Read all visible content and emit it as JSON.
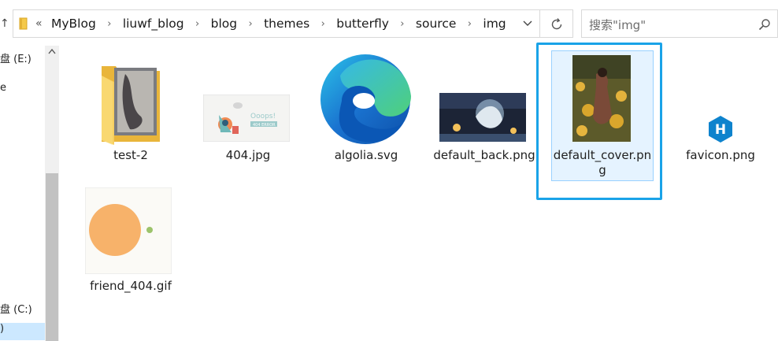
{
  "address_bar": {
    "overflow_symbol": "«",
    "breadcrumbs": [
      "MyBlog",
      "liuwf_blog",
      "blog",
      "themes",
      "butterfly",
      "source",
      "img"
    ],
    "separator": "›"
  },
  "search": {
    "placeholder": "搜索\"img\""
  },
  "nav_pane": {
    "items": [
      {
        "label": "盘 (E:)"
      },
      {
        "label": "e"
      },
      {
        "label": "盘 (C:)"
      },
      {
        "label": ")"
      }
    ]
  },
  "files": [
    {
      "name": "test-2",
      "type": "folder"
    },
    {
      "name": "404.jpg",
      "type": "image"
    },
    {
      "name": "algolia.svg",
      "type": "svg"
    },
    {
      "name": "default_back.png",
      "type": "image"
    },
    {
      "name": "default_cover.png",
      "type": "image",
      "selected": true
    },
    {
      "name": "favicon.png",
      "type": "image"
    },
    {
      "name": "friend_404.gif",
      "type": "gif"
    }
  ],
  "thumb_text": {
    "ooops": "Ooops!",
    "error_code": "404 ERROR",
    "hexo_letter": "H"
  },
  "colors": {
    "selection_border": "#1aa3e8",
    "selection_fill": "#e5f3ff",
    "folder_yellow": "#f5c94a",
    "edge_blue": "#1a73d0",
    "edge_green": "#4fd07a",
    "hexo_blue": "#0e83cd",
    "friend_orange": "#f7b26a",
    "friend_green": "#9cc36b"
  }
}
